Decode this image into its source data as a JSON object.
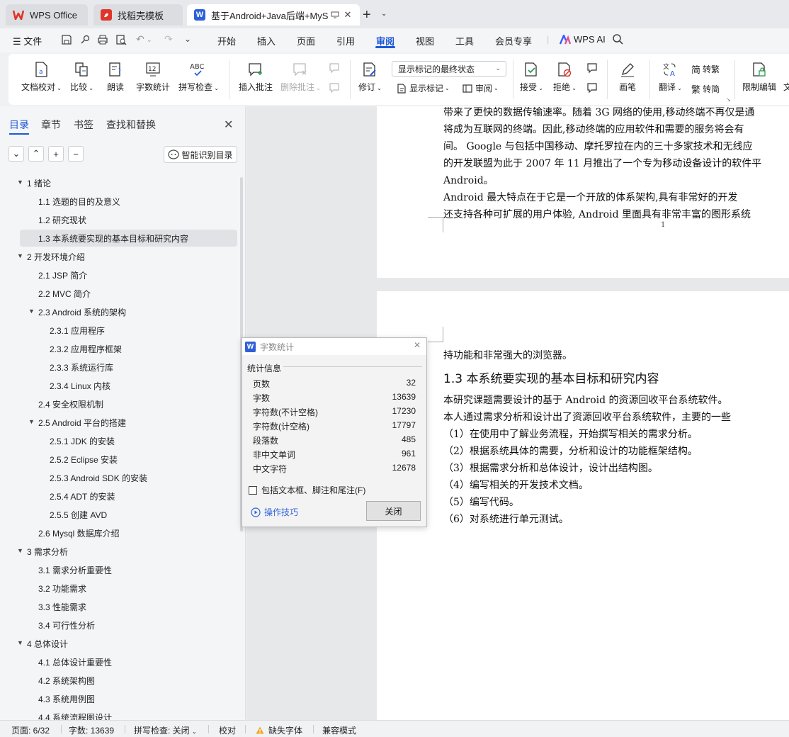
{
  "tabs": [
    {
      "label": "WPS Office"
    },
    {
      "label": "找稻壳模板"
    },
    {
      "label": "基于Android+Java后端+MyS"
    }
  ],
  "menu": {
    "file": "文件",
    "items": [
      "开始",
      "插入",
      "页面",
      "引用",
      "审阅",
      "视图",
      "工具",
      "会员专享"
    ],
    "active": "审阅",
    "wps_ai": "WPS AI"
  },
  "ribbon": {
    "doc_check": "文档校对",
    "compare": "比较",
    "read_aloud": "朗读",
    "word_count": "字数统计",
    "spell_check": "拼写检查",
    "insert_comment": "插入批注",
    "delete_comment": "删除批注",
    "revise": "修订",
    "markup_state": "显示标记的最终状态",
    "show_markup": "显示标记",
    "review": "审阅",
    "accept": "接受",
    "reject": "拒绝",
    "pen": "画笔",
    "translate": "翻译",
    "to_traditional": "转繁",
    "to_simplified": "转简",
    "restrict_edit": "限制编辑",
    "more": "文"
  },
  "sidebar": {
    "tabs": [
      "目录",
      "章节",
      "书签",
      "查找和替换"
    ],
    "smart_toc": "智能识别目录",
    "toc": [
      {
        "text": "1  绪论",
        "level": 1,
        "expanded": true
      },
      {
        "text": "1.1  选题的目的及意义",
        "level": 2
      },
      {
        "text": "1.2  研究现状",
        "level": 2
      },
      {
        "text": "1.3  本系统要实现的基本目标和研究内容",
        "level": 2,
        "selected": true
      },
      {
        "text": "2  开发环境介绍",
        "level": 1,
        "expanded": true
      },
      {
        "text": "2.1 JSP 简介",
        "level": 2
      },
      {
        "text": "2.2 MVC 简介",
        "level": 2
      },
      {
        "text": "2.3 Android 系统的架构",
        "level": 2,
        "expanded": true
      },
      {
        "text": "2.3.1  应用程序",
        "level": 3
      },
      {
        "text": "2.3.2  应用程序框架",
        "level": 3
      },
      {
        "text": "2.3.3  系统运行库",
        "level": 3
      },
      {
        "text": "2.3.4 Linux 内核",
        "level": 3
      },
      {
        "text": "2.4  安全权限机制",
        "level": 2
      },
      {
        "text": "2.5 Android 平台的搭建",
        "level": 2,
        "expanded": true
      },
      {
        "text": "2.5.1 JDK 的安装",
        "level": 3
      },
      {
        "text": "2.5.2 Eclipse 安装",
        "level": 3
      },
      {
        "text": "2.5.3 Android SDK 的安装",
        "level": 3
      },
      {
        "text": "2.5.4 ADT 的安装",
        "level": 3
      },
      {
        "text": "2.5.5  创建 AVD",
        "level": 3
      },
      {
        "text": "2.6 Mysql 数据库介绍",
        "level": 2
      },
      {
        "text": "3  需求分析",
        "level": 1,
        "expanded": true
      },
      {
        "text": "3.1  需求分析重要性",
        "level": 2
      },
      {
        "text": "3.2  功能需求",
        "level": 2
      },
      {
        "text": "3.3  性能需求",
        "level": 2
      },
      {
        "text": "3.4  可行性分析",
        "level": 2
      },
      {
        "text": "4  总体设计",
        "level": 1,
        "expanded": true
      },
      {
        "text": "4.1  总体设计重要性",
        "level": 2
      },
      {
        "text": "4.2  系统架构图",
        "level": 2
      },
      {
        "text": "4.3  系统用例图",
        "level": 2
      },
      {
        "text": "4.4  系统流程图设计",
        "level": 2
      }
    ]
  },
  "document": {
    "page1_lines": [
      "带来了更快的数据传输速率。随着 3G 网络的使用,移动终端不再仅是通",
      "将成为互联网的终端。因此,移动终端的应用软件和需要的服务将会有",
      "间。  Google 与包括中国移动、摩托罗拉在内的三十多家技术和无线应",
      "的开发联盟为此于 2007 年 11 月推出了一个专为移动设备设计的软件平",
      "Android。",
      "    Android 最大特点在于它是一个开放的体系架构,具有非常好的开发",
      "还支持各种可扩展的用户体验,  Android 里面具有非常丰富的图形系统"
    ],
    "page_number": "1",
    "page2_first": "持功能和非常强大的浏览器。",
    "heading": "1.3  本系统要实现的基本目标和研究内容",
    "page2_lines": [
      "    本研究课题需要设计的基于 Android 的资源回收平台系统软件。",
      "    本人通过需求分析和设计出了资源回收平台系统软件，主要的一些",
      "  （1）在使用中了解业务流程，开始撰写相关的需求分析。",
      "  （2）根据系统具体的需要，分析和设计的功能框架结构。",
      "  （3）根据需求分析和总体设计，设计出结构图。",
      "  （4）编写相关的开发技术文档。",
      "  （5）编写代码。",
      "  （6）对系统进行单元测试。"
    ]
  },
  "dialog": {
    "title": "字数统计",
    "section": "统计信息",
    "rows": [
      {
        "label": "页数",
        "value": "32"
      },
      {
        "label": "字数",
        "value": "13639"
      },
      {
        "label": "字符数(不计空格)",
        "value": "17230"
      },
      {
        "label": "字符数(计空格)",
        "value": "17797"
      },
      {
        "label": "段落数",
        "value": "485"
      },
      {
        "label": "非中文单词",
        "value": "961"
      },
      {
        "label": "中文字符",
        "value": "12678"
      }
    ],
    "checkbox": "包括文本框、脚注和尾注(F)",
    "tips": "操作技巧",
    "close": "关闭"
  },
  "status": {
    "page": "页面: 6/32",
    "words": "字数: 13639",
    "spell": "拼写检查: 关闭",
    "proof": "校对",
    "missing_font": "缺失字体",
    "compat": "兼容模式"
  },
  "colors": {
    "accent": "#1e58d8",
    "wps_red": "#e0352b"
  }
}
